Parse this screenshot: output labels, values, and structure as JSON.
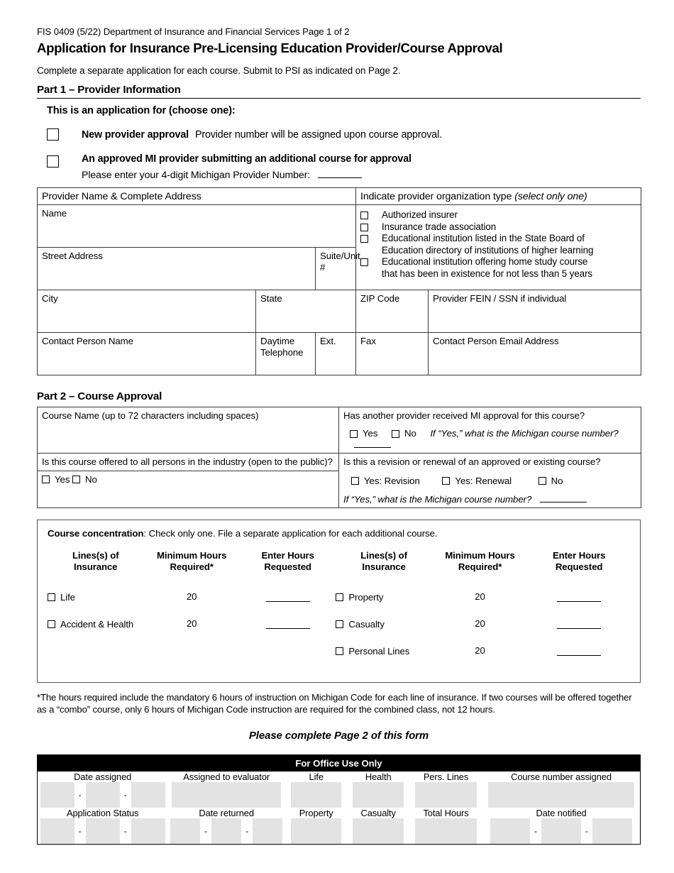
{
  "header": {
    "form_code_line": "FIS 0409 (5/22) Department of Insurance and Financial Services  Page 1 of 2",
    "title": "Application for Insurance Pre-Licensing Education Provider/Course Approval",
    "subtitle": "Complete a separate application for each course. Submit to PSI as indicated on Page 2."
  },
  "part1": {
    "heading": "Part 1 – Provider Information",
    "choose_title": "This is an application for (choose one):",
    "option1_bold": "New provider approval",
    "option1_rest": "Provider number will be assigned upon course approval.",
    "option2_bold": "An approved MI provider submitting an additional course for approval",
    "option2_line2": "Please enter your 4-digit Michigan Provider Number:",
    "address_header": "Provider Name & Complete Address",
    "orgtype_header": "Indicate provider organization type",
    "orgtype_header_italic": "(select only one)",
    "fields": {
      "name": "Name",
      "street_address": "Street Address",
      "suite_unit": "Suite/Unit #",
      "city": "City",
      "state": "State",
      "zip_code": "ZIP Code",
      "fein_ssn": "Provider FEIN / SSN if individual",
      "contact_person_name": "Contact Person Name",
      "daytime_telephone": "Daytime Telephone",
      "ext": "Ext.",
      "fax": "Fax",
      "contact_email": "Contact Person Email Address"
    },
    "org_options": [
      {
        "label": "Authorized insurer",
        "continuation": ""
      },
      {
        "label": "Insurance trade association",
        "continuation": ""
      },
      {
        "label": "Educational institution listed in the State Board of",
        "continuation": "Education directory of institutions of higher learning"
      },
      {
        "label": "Educational institution offering home study course",
        "continuation": "that has been in existence for not less than 5 years"
      }
    ]
  },
  "part2": {
    "heading": "Part 2 – Course Approval",
    "course_name_label": "Course Name (up to 72 characters including spaces)",
    "open_to_public_question": "Is this course offered to all persons in the industry (open to the public)?",
    "open_to_public_options": [
      "Yes",
      "No"
    ],
    "another_provider_question": "Has another provider received MI approval for this course?",
    "another_provider_yes": "Yes",
    "another_provider_no": "No",
    "another_provider_followup": "If “Yes,” what is the Michigan course number?",
    "revision_question": "Is this a revision or renewal of an approved or existing course?",
    "revision_options": [
      "Yes:  Revision",
      "Yes:  Renewal",
      "No"
    ],
    "revision_followup": "If “Yes,” what is the Michigan course number?"
  },
  "concentration": {
    "title_bold": "Course concentration",
    "title_rest": ":  Check only one.  File a separate application for each additional course.",
    "columns": {
      "lines_l1": "Lines(s) of",
      "lines_l2": "Insurance",
      "minhours_l1": "Minimum Hours",
      "minhours_l2": "Required*",
      "enterhours_l1": "Enter Hours",
      "enterhours_l2": "Requested"
    },
    "left_rows": [
      {
        "line": "Life",
        "hours": "20"
      },
      {
        "line": "Accident & Health",
        "hours": "20"
      }
    ],
    "right_rows": [
      {
        "line": "Property",
        "hours": "20"
      },
      {
        "line": "Casualty",
        "hours": "20"
      },
      {
        "line": "Personal Lines",
        "hours": "20"
      }
    ],
    "footnote": "*The hours required include the mandatory 6 hours of instruction on Michigan Code for each line of insurance.  If two courses will be offered together as a “combo” course, only 6 hours of Michigan Code instruction are required for the combined class, not 12 hours.",
    "please_complete": "Please complete Page 2 of this form"
  },
  "office_use": {
    "title": "For Office Use Only",
    "row1": {
      "date_assigned": "Date assigned",
      "assigned_to_evaluator": "Assigned to evaluator",
      "life": "Life",
      "health": "Health",
      "pers_lines": "Pers. Lines",
      "course_number_assigned": "Course number assigned"
    },
    "row2": {
      "application_status": "Application Status",
      "date_returned": "Date returned",
      "property": "Property",
      "casualty": "Casualty",
      "total_hours": "Total Hours",
      "date_notified": "Date notified"
    },
    "date_separator": "-"
  },
  "colors": {
    "office_title_bg": "#000000",
    "field_fill": "#e3e3e3",
    "border": "#3a3a3a"
  }
}
